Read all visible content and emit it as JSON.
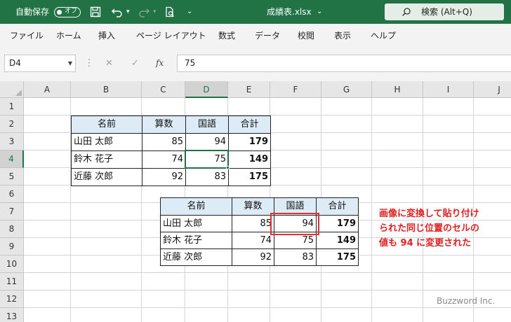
{
  "titlebar": {
    "autosave_label": "自動保存",
    "autosave_state": "オフ",
    "filename": "成績表.xlsx",
    "search_placeholder": "検索 (Alt+Q)"
  },
  "menu": [
    "ファイル",
    "ホーム",
    "挿入",
    "ページ レイアウト",
    "数式",
    "データ",
    "校閲",
    "表示",
    "ヘルプ"
  ],
  "formula_bar": {
    "name_box": "D4",
    "fx_label": "fx",
    "value": "75"
  },
  "columns": [
    "A",
    "B",
    "C",
    "D",
    "E",
    "F",
    "G",
    "H",
    "I",
    "J"
  ],
  "rows": [
    "1",
    "2",
    "3",
    "4",
    "5",
    "6",
    "7",
    "8",
    "9",
    "10",
    "11",
    "12",
    "13"
  ],
  "selected_cell": "D4",
  "table": {
    "headers": [
      "名前",
      "算数",
      "国語",
      "合計"
    ],
    "rows": [
      [
        "山田 太郎",
        "85",
        "94",
        "179"
      ],
      [
        "鈴木 花子",
        "74",
        "75",
        "149"
      ],
      [
        "近藤 次郎",
        "92",
        "83",
        "175"
      ]
    ]
  },
  "picture": {
    "headers": [
      "名前",
      "算数",
      "国語",
      "合計"
    ],
    "rows": [
      [
        "山田 太郎",
        "85",
        "94",
        "179"
      ],
      [
        "鈴木 花子",
        "74",
        "75",
        "149"
      ],
      [
        "近藤 次郎",
        "92",
        "83",
        "175"
      ]
    ]
  },
  "annotation": [
    "画像に変換して貼り付け",
    "られた同じ位置のセルの",
    "値も 94 に変更された"
  ],
  "watermark": "Buzzword Inc.",
  "colors": {
    "excel_green": "#217346",
    "header_fill": "#ddebf7",
    "annotation_red": "#e02020"
  }
}
